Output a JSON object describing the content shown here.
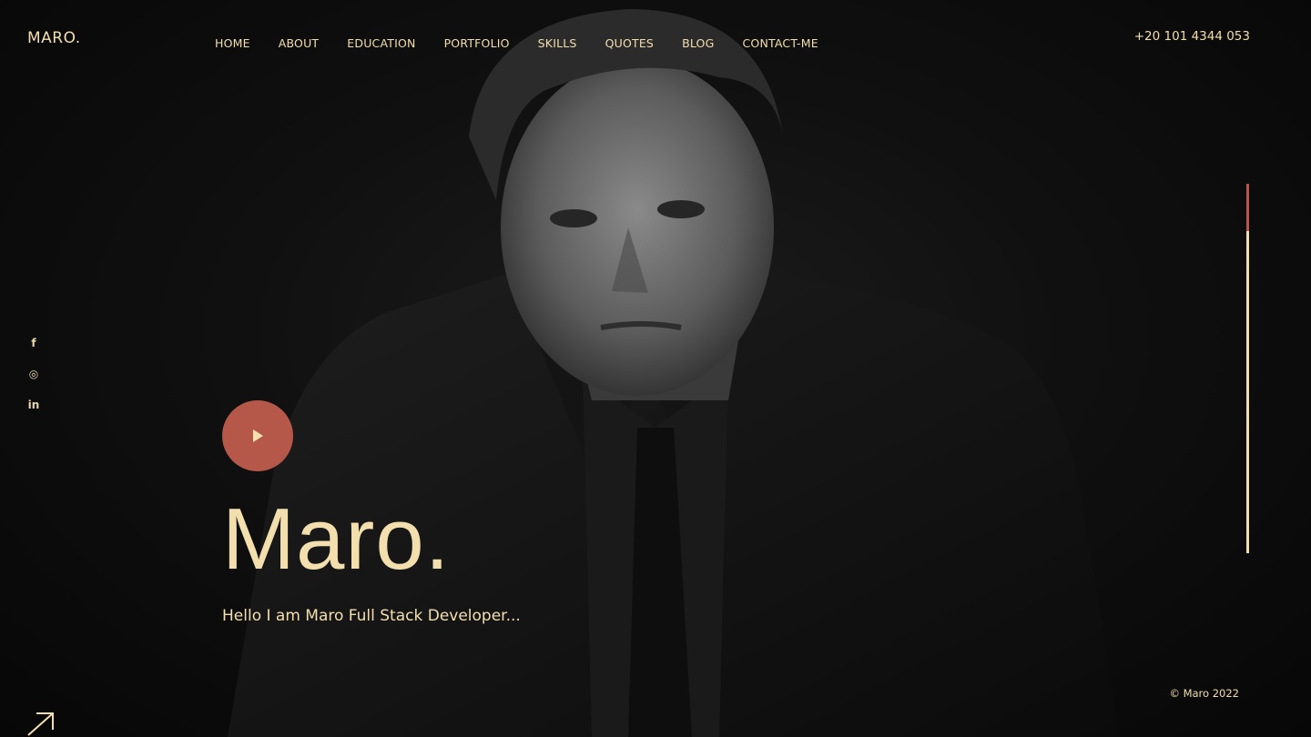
{
  "brand": {
    "logo": "MARO."
  },
  "nav": {
    "items": [
      "HOME",
      "ABOUT",
      "EDUCATION",
      "PORTFOLIO",
      "SKILLS",
      "QUOTES",
      "BLOG",
      "CONTACT-ME"
    ]
  },
  "header": {
    "phone": "+20 101 4344 053"
  },
  "social": {
    "items": [
      {
        "icon": "facebook-icon",
        "glyph": "f"
      },
      {
        "icon": "instagram-icon",
        "glyph": "◎"
      },
      {
        "icon": "linkedin-icon",
        "glyph": "in"
      }
    ]
  },
  "hero": {
    "title": "Maro.",
    "subtitle": "Hello I am Maro Full Stack Developer..."
  },
  "footer": {
    "copyright": "© Maro 2022"
  },
  "colors": {
    "accent": "#f3dfae",
    "play_button": "#b5584a",
    "background": "#0c0c0c"
  },
  "scroll": {
    "progress": 0.13
  }
}
